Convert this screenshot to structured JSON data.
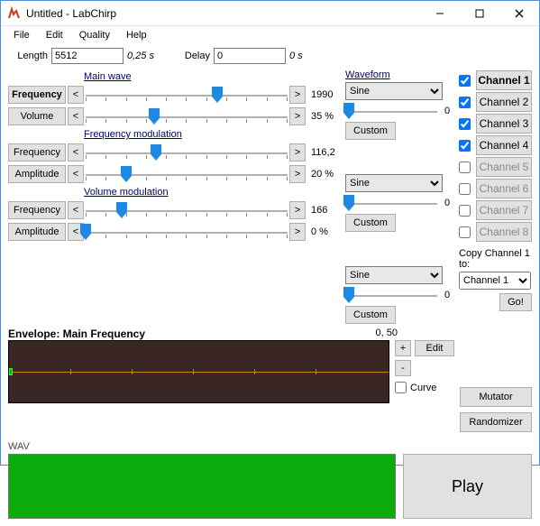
{
  "window": {
    "title": "Untitled - LabChirp"
  },
  "menu": [
    "File",
    "Edit",
    "Quality",
    "Help"
  ],
  "top": {
    "length_label": "Length",
    "length_value": "5512",
    "length_suffix": "0,25 s",
    "delay_label": "Delay",
    "delay_value": "0",
    "delay_suffix": "0 s"
  },
  "sections": {
    "main": "Main wave",
    "freqmod": "Frequency modulation",
    "volmod": "Volume modulation"
  },
  "params": {
    "frequency": {
      "label": "Frequency",
      "value": "1990",
      "pos": 65
    },
    "volume": {
      "label": "Volume",
      "value": "35 %",
      "pos": 34
    },
    "fm_freq": {
      "label": "Frequency",
      "value": "116,2",
      "pos": 35
    },
    "fm_amp": {
      "label": "Amplitude",
      "value": "20 %",
      "pos": 20
    },
    "vm_freq": {
      "label": "Frequency",
      "value": "166",
      "pos": 18
    },
    "vm_amp": {
      "label": "Amplitude",
      "value": "0 %",
      "pos": 0
    }
  },
  "arrows": {
    "left": "<",
    "right": ">"
  },
  "waveform": {
    "header": "Waveform",
    "options": [
      "Sine"
    ],
    "slider_value": "0",
    "custom": "Custom"
  },
  "channels": {
    "items": [
      {
        "label": "Channel 1",
        "checked": true,
        "enabled": true,
        "active": true
      },
      {
        "label": "Channel 2",
        "checked": true,
        "enabled": true,
        "active": false
      },
      {
        "label": "Channel 3",
        "checked": true,
        "enabled": true,
        "active": false
      },
      {
        "label": "Channel 4",
        "checked": true,
        "enabled": true,
        "active": false
      },
      {
        "label": "Channel 5",
        "checked": false,
        "enabled": false,
        "active": false
      },
      {
        "label": "Channel 6",
        "checked": false,
        "enabled": false,
        "active": false
      },
      {
        "label": "Channel 7",
        "checked": false,
        "enabled": false,
        "active": false
      },
      {
        "label": "Channel 8",
        "checked": false,
        "enabled": false,
        "active": false
      }
    ],
    "copy_label": "Copy Channel 1 to:",
    "copy_target": "Channel 1",
    "go": "Go!"
  },
  "envelope": {
    "title": "Envelope: Main Frequency",
    "value": "0, 50",
    "edit": "Edit",
    "plus": "+",
    "minus": "-",
    "curve": "Curve"
  },
  "wav_label": "WAV",
  "buttons": {
    "mutator": "Mutator",
    "randomizer": "Randomizer",
    "play": "Play"
  }
}
